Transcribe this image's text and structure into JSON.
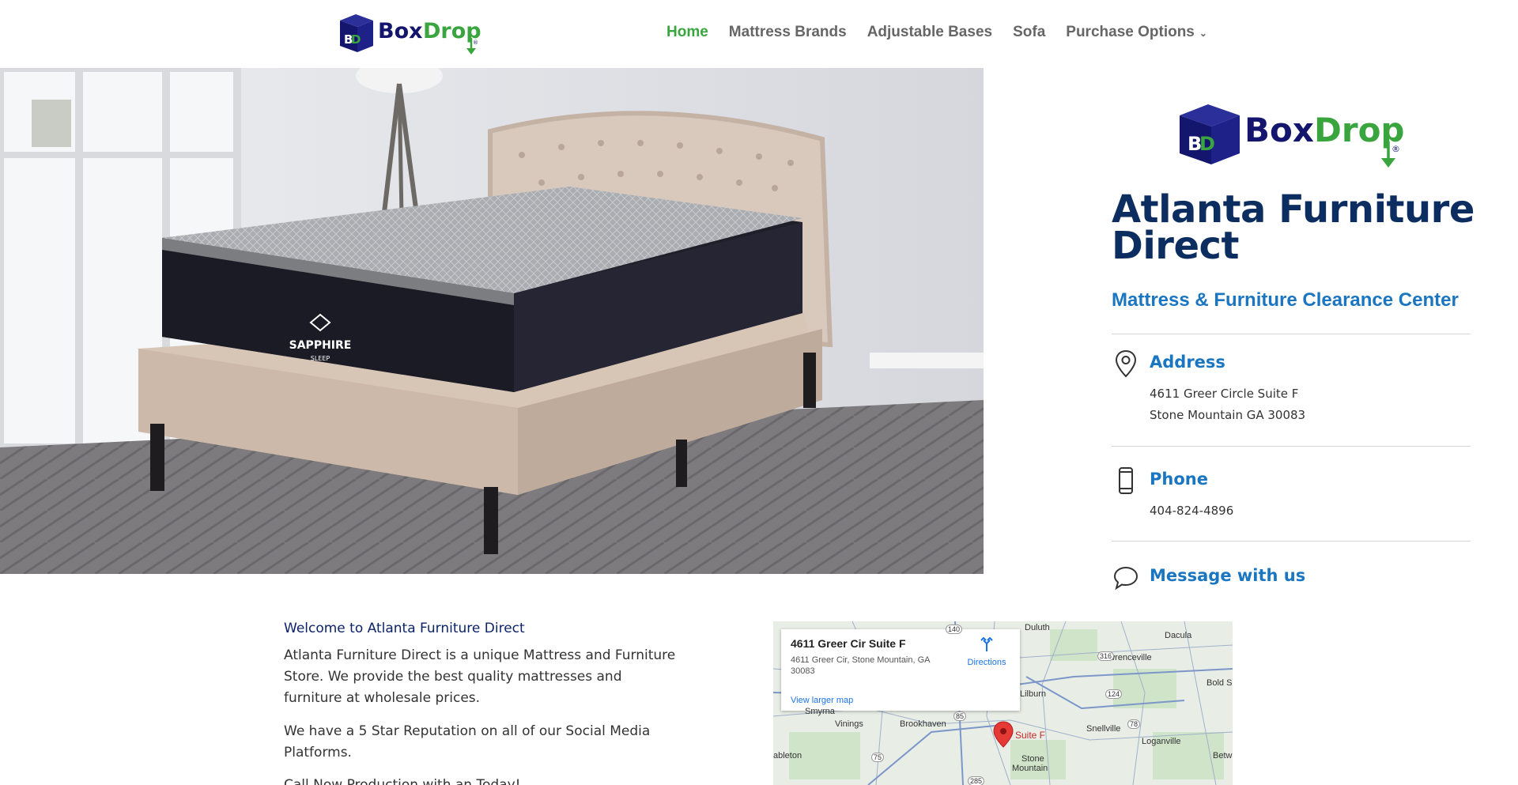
{
  "brand": {
    "name_part1": "Box",
    "name_part2": "Drop",
    "mark": "BD",
    "registered": "®"
  },
  "nav": {
    "items": [
      {
        "label": "Home",
        "active": true
      },
      {
        "label": "Mattress Brands",
        "active": false
      },
      {
        "label": "Adjustable Bases",
        "active": false
      },
      {
        "label": "Sofa",
        "active": false
      },
      {
        "label": "Purchase Options",
        "active": false,
        "dropdown": true
      }
    ]
  },
  "hero": {
    "mattress_brand": "SAPPHIRE",
    "mattress_sub": "SLEEP"
  },
  "business": {
    "name_line1": "Atlanta Furniture",
    "name_line2": "Direct",
    "tagline": "Mattress & Furniture Clearance Center"
  },
  "contact": {
    "address_title": "Address",
    "address_line1": "4611 Greer Circle Suite F",
    "address_line2": "Stone Mountain GA 30083",
    "phone_title": "Phone",
    "phone": "404-824-4896",
    "message_title": "Message with us"
  },
  "about": {
    "title": "Welcome to Atlanta Furniture Direct",
    "p1": "Atlanta Furniture Direct is a unique Mattress and Furniture Store. We provide the best quality mattresses and furniture at wholesale prices.",
    "p2": "We have a 5 Star Reputation on all of our Social Media Platforms.",
    "p3": "Call Now Production with an Today!"
  },
  "map": {
    "card_title": "4611 Greer Cir Suite F",
    "card_address": "4611 Greer Cir, Stone Mountain, GA 30083",
    "directions": "Directions",
    "larger_map": "View larger map",
    "pin_label": "Suite F",
    "places": [
      "Duluth",
      "Dacula",
      "Lawrenceville",
      "Lilburn",
      "Bold S",
      "Smyrna",
      "Vinings",
      "Brookhaven",
      "Snellville",
      "Loganville",
      "ableton",
      "Stone",
      "Mountain",
      "Betw"
    ],
    "routes": [
      "140",
      "316",
      "124",
      "85",
      "78",
      "75",
      "285"
    ]
  },
  "colors": {
    "brand_navy": "#14166e",
    "brand_green": "#3aa53f",
    "accent_blue": "#1a76c1",
    "heading_navy": "#0c2d5f"
  }
}
